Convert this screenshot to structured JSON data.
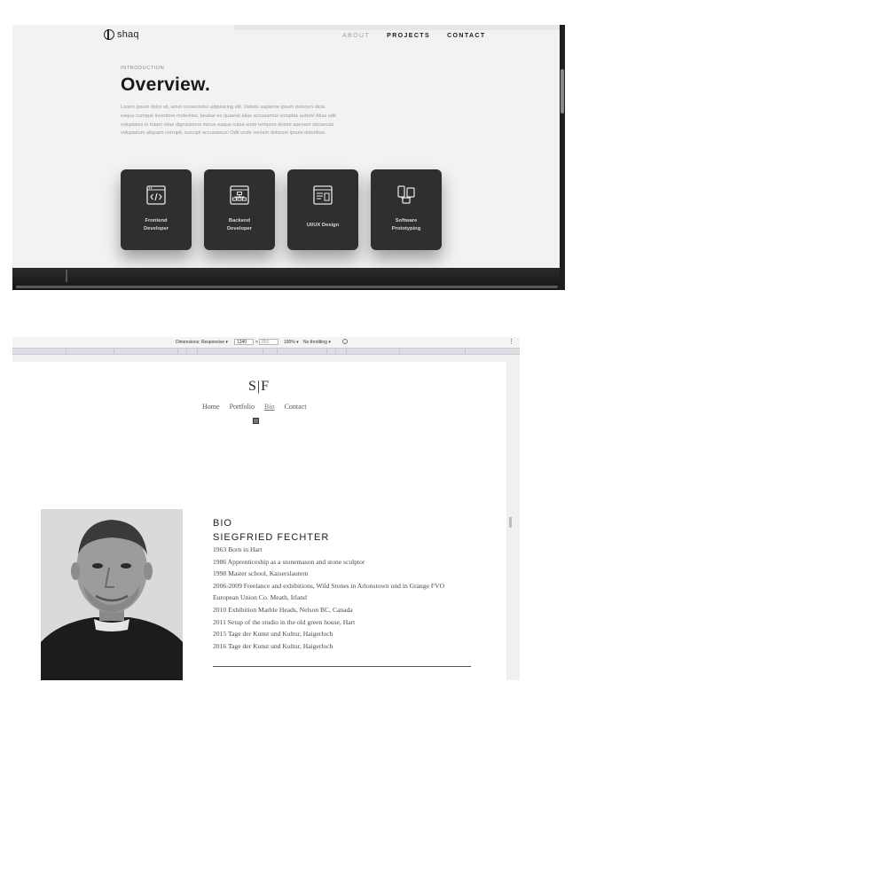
{
  "shot1": {
    "logo_text": "shaq",
    "nav": [
      "ABOUT",
      "PROJECTS",
      "CONTACT"
    ],
    "eyebrow": "INTRODUCTION",
    "heading": "Overview.",
    "body": "Lorem ipsum dolor sit, amet consectetur adipisicing elit. Debitis sapiente ipsum dolorum dicta eaque cumque inventore molestias, beatae ex quaerat alias accusamus voluptas autem! Alias odit voluptates in totam vitae dignissimos minus eaque culpa unde tempore dolore aperiam obcaecati voluptatum aliquam corrupti, suscipit accusamus! Odit unde veniam dolorum ipsum doloribus.",
    "cards": [
      {
        "label": "Frontend\nDeveloper",
        "icon": "code-window-icon"
      },
      {
        "label": "Backend\nDeveloper",
        "icon": "sitemap-window-icon"
      },
      {
        "label": "UI/UX Design",
        "icon": "layout-window-icon"
      },
      {
        "label": "Software\nPrototyping",
        "icon": "devices-icon"
      }
    ]
  },
  "shot2": {
    "devtools": {
      "dimensions": "Dimensions: Responsive ▾",
      "width": "1340",
      "times": "×",
      "height": "850",
      "zoom": "100% ▾",
      "throttle": "No throttling ▾",
      "more": "⋮"
    },
    "logo": "S|F",
    "nav": [
      "Home",
      "Portfolio",
      "Bio",
      "Contact"
    ],
    "bio_title": "BIO",
    "bio_name": "SIEGFRIED FECHTER",
    "bio_lines": [
      "1963 Born in Hart",
      "1986 Apprenticeship as a stonemason and stone sculptor",
      "1998 Master school, Kaiserslautern",
      "2006-2009 Freelance and exhibitions, Wild Stones in Arlonstown und in Grange FVO",
      "European Union Co. Meath, Irland",
      "2010 Exhibition Marble Heads, Nelson BC, Canada",
      "2011 Setup of the studio in the old green house, Hart",
      "2015 Tage der Kunst und Kultur, Haigerloch",
      "2016 Tage der Kunst und Kultur, Haigerloch"
    ]
  }
}
